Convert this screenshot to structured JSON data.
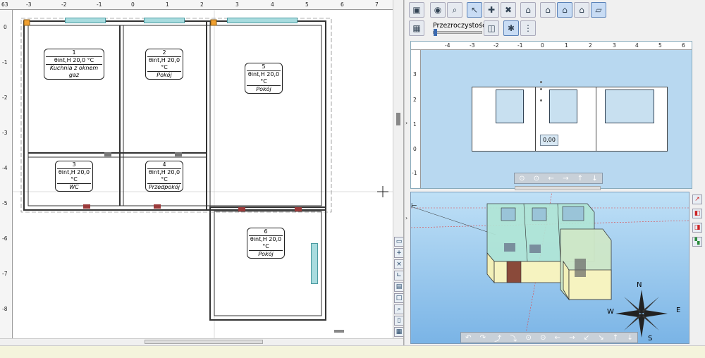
{
  "plan": {
    "ruler_top_ticks": [
      "63",
      "-3",
      "-2",
      "-1",
      "0",
      "1",
      "2",
      "3",
      "4",
      "5",
      "6",
      "7"
    ],
    "ruler_left_ticks": [
      "0",
      "-1",
      "-2",
      "-3",
      "-4",
      "-5",
      "-6",
      "-7",
      "-8"
    ],
    "rooms": [
      {
        "num": "1",
        "temp": "θint,H 20,0 °C",
        "name": "Kuchnia z oknem gaz"
      },
      {
        "num": "2",
        "temp": "θint,H 20,0 °C",
        "name": "Pokój"
      },
      {
        "num": "5",
        "temp": "θint,H 20,0 °C",
        "name": "Pokój"
      },
      {
        "num": "3",
        "temp": "θint,H 20,0 °C",
        "name": "WC"
      },
      {
        "num": "4",
        "temp": "θint,H 20,0 °C",
        "name": "Przedpokój"
      },
      {
        "num": "6",
        "temp": "θint,H 20,0 °C",
        "name": "Pokój"
      }
    ]
  },
  "toolbar": {
    "transparency_label": "Przezroczystość"
  },
  "elevation": {
    "ruler_top_ticks": [
      "-4",
      "-3",
      "-2",
      "-1",
      "0",
      "1",
      "2",
      "3",
      "4",
      "5",
      "6"
    ],
    "ruler_left_ticks": [
      "3",
      "2",
      "1",
      "0",
      "-1"
    ],
    "value_box": "0,00"
  },
  "compass": {
    "n": "N",
    "e": "E",
    "s": "S",
    "w": "W"
  },
  "colors": {
    "elev_bg": "#b8d8f0",
    "view3d_bg": "#7ab4e6",
    "window": "#a8dcdf"
  }
}
